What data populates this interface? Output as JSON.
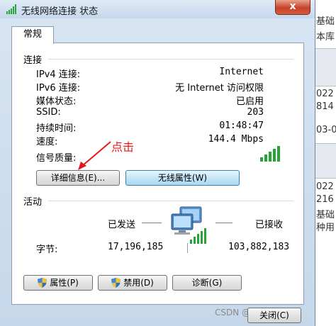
{
  "window": {
    "title": "无线网络连接 状态",
    "close_glyph": "x"
  },
  "tab": {
    "label": "常规"
  },
  "connection": {
    "heading": "连接",
    "rows": [
      {
        "label": "IPv4 连接:",
        "value": "Internet"
      },
      {
        "label": "IPv6 连接:",
        "value": "无 Internet 访问权限"
      },
      {
        "label": "媒体状态:",
        "value": "已启用"
      },
      {
        "label": "SSID:",
        "value": "203"
      },
      {
        "label": "持续时间:",
        "value": "01:48:47"
      },
      {
        "label": "速度:",
        "value": "144.4 Mbps"
      }
    ],
    "signal_label": "信号质量:",
    "signal_bars_lit": 5,
    "signal_bars_total": 5
  },
  "annotation": {
    "text": "点击",
    "color": "#e21a1a"
  },
  "buttons": {
    "details": "详细信息(E)...",
    "wireless_properties": "无线属性(W)",
    "properties": "属性(P)",
    "disable": "禁用(D)",
    "diagnose": "诊断(G)",
    "close": "关闭(C)"
  },
  "activity": {
    "heading": "活动",
    "sent_label": "已发送",
    "received_label": "已接收",
    "bytes_label": "字节:",
    "bytes_sent": "17,196,185",
    "bytes_received": "103,882,183"
  },
  "background": {
    "fragments": [
      "基础",
      "本库",
      "022",
      "814",
      "03-0",
      "022",
      "216",
      "基础",
      "种用"
    ]
  },
  "watermark": {
    "text": "CSDN @m..._09203"
  },
  "colors": {
    "accent": "#3c7fb1",
    "signal_green": "#27a33a",
    "annotation_red": "#e21a1a"
  }
}
